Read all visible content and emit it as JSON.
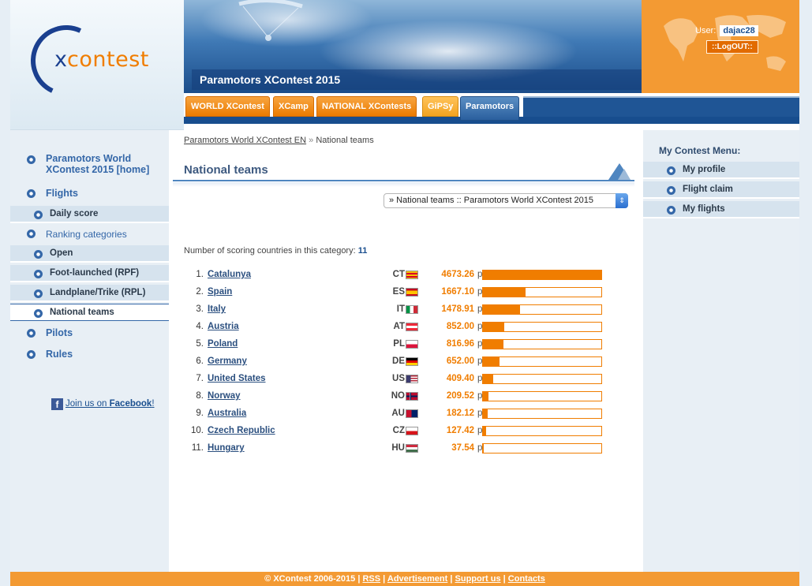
{
  "logo": {
    "x": "x",
    "rest": "contest"
  },
  "banner": {
    "title": "Paramotors XContest 2015"
  },
  "user": {
    "label": "User:",
    "name": "dajac28",
    "logout": "::LogOUT::"
  },
  "tabs": [
    {
      "label": "WORLD XContest"
    },
    {
      "label": "XCamp"
    },
    {
      "label": "NATIONAL XContests"
    },
    {
      "label": "GiPSy"
    },
    {
      "label": "Paramotors"
    }
  ],
  "leftnav": {
    "home": "Paramotors World XContest 2015 [home]",
    "flights": "Flights",
    "daily_score": "Daily score",
    "ranking": "Ranking categories",
    "open": "Open",
    "foot": "Foot-launched (RPF)",
    "land": "Landplane/Trike (RPL)",
    "national": "National teams",
    "pilots": "Pilots",
    "rules": "Rules",
    "facebook_prefix": "Join us on ",
    "facebook_name": "Facebook",
    "facebook_suffix": "!"
  },
  "breadcrumb": {
    "link": "Paramotors World XContest EN",
    "sep": "»",
    "current": "National teams"
  },
  "page_title": "National teams",
  "select": {
    "value": "» National teams :: Paramotors World XContest 2015"
  },
  "count": {
    "label": "Number of scoring countries in this category:",
    "value": "11"
  },
  "points_unit": "p.",
  "ranking": [
    {
      "rank": "1.",
      "name": "Catalunya",
      "code": "CT",
      "points": "4673.26",
      "ratio": 1.0
    },
    {
      "rank": "2.",
      "name": "Spain",
      "code": "ES",
      "points": "1667.10",
      "ratio": 0.357
    },
    {
      "rank": "3.",
      "name": "Italy",
      "code": "IT",
      "points": "1478.91",
      "ratio": 0.316
    },
    {
      "rank": "4.",
      "name": "Austria",
      "code": "AT",
      "points": "852.00",
      "ratio": 0.182
    },
    {
      "rank": "5.",
      "name": "Poland",
      "code": "PL",
      "points": "816.96",
      "ratio": 0.175
    },
    {
      "rank": "6.",
      "name": "Germany",
      "code": "DE",
      "points": "652.00",
      "ratio": 0.14
    },
    {
      "rank": "7.",
      "name": "United States",
      "code": "US",
      "points": "409.40",
      "ratio": 0.088
    },
    {
      "rank": "8.",
      "name": "Norway",
      "code": "NO",
      "points": "209.52",
      "ratio": 0.045
    },
    {
      "rank": "9.",
      "name": "Australia",
      "code": "AU",
      "points": "182.12",
      "ratio": 0.039
    },
    {
      "rank": "10.",
      "name": "Czech Republic",
      "code": "CZ",
      "points": "127.42",
      "ratio": 0.027
    },
    {
      "rank": "11.",
      "name": "Hungary",
      "code": "HU",
      "points": "37.54",
      "ratio": 0.008
    }
  ],
  "rightnav": {
    "title": "My Contest Menu:",
    "items": [
      {
        "label": "My profile"
      },
      {
        "label": "Flight claim"
      },
      {
        "label": "My flights"
      }
    ]
  },
  "footer": {
    "copyright": "© XContest 2006-2015",
    "sep": "|",
    "links": [
      "RSS",
      "Advertisement",
      "Support us",
      "Contacts"
    ]
  },
  "colors": {
    "accent_orange": "#f07d00",
    "nav_blue": "#3467a8",
    "tab_blue": "#174d8e"
  }
}
